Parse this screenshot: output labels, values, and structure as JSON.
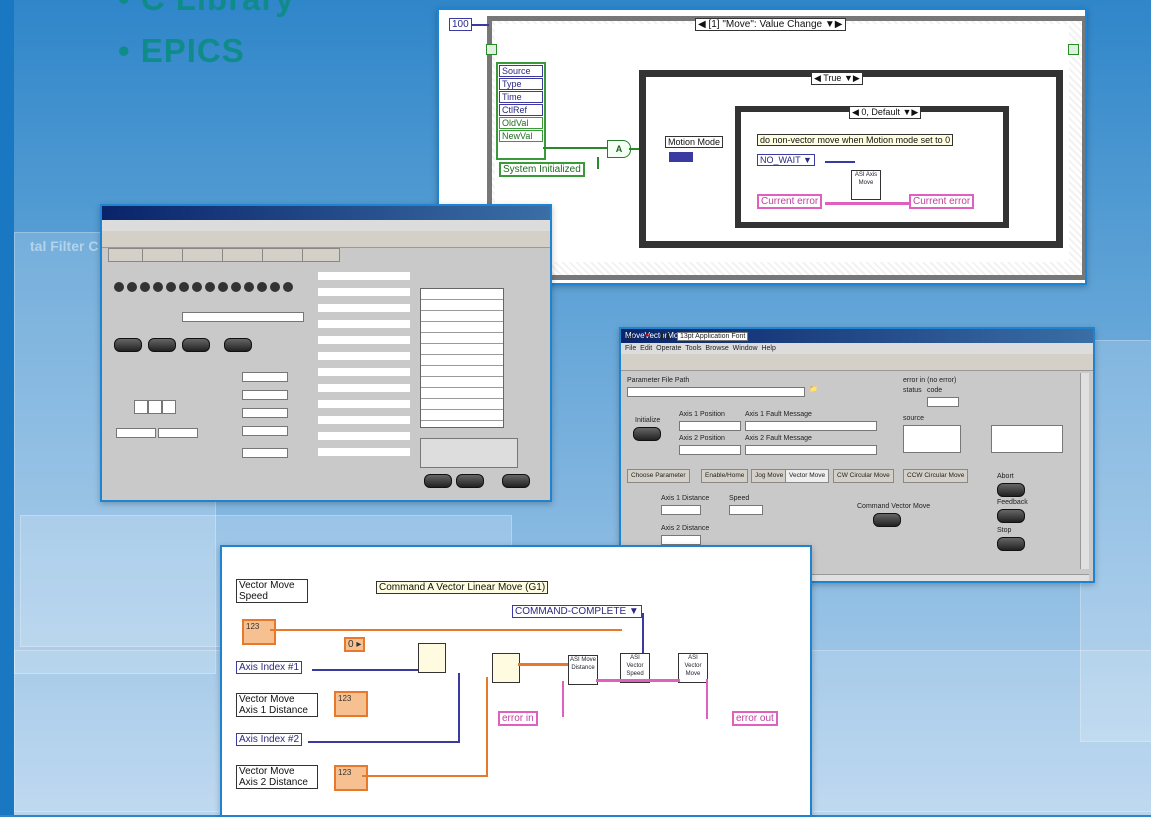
{
  "bullets": [
    "C Library",
    "EPICS"
  ],
  "event_diagram": {
    "loop_count": "100",
    "event_case": "[1] \"Move\": Value Change",
    "event_terminals": [
      "Source",
      "Type",
      "Time",
      "CtlRef",
      "OldVal",
      "NewVal"
    ],
    "system_initialized": "System Initialized",
    "true_case": "True",
    "default_case": "0, Default",
    "motion_mode": "Motion Mode",
    "comment": "do non-vector move when Motion mode set to 0",
    "no_wait": "NO_WAIT",
    "axis_move_vi": "ASI Axis Move",
    "current_error_in": "Current error",
    "current_error_out": "Current error"
  },
  "vector_diagram": {
    "speed_label": "Vector Move Speed",
    "title": "Command A Vector Linear Move (G1)",
    "command_complete": "COMMAND-COMPLETE",
    "axis1": "Axis Index #1",
    "axis2": "Axis Index #2",
    "dist1": "Vector Move Axis 1 Distance",
    "dist2": "Vector Move Axis 2 Distance",
    "error_in": "error in",
    "error_out": "error out",
    "vi_move_distance": "ASI Move Distance",
    "vi_vector_speed": "ASI Vector Speed",
    "vi_vector_move": "ASI Vector Move",
    "const_zero": "0",
    "num_123": "123"
  },
  "front_panel": {
    "title": "MoveVectorMotion.vi Front Panel *",
    "menu": [
      "File",
      "Edit",
      "Operate",
      "Tools",
      "Browse",
      "Window",
      "Help"
    ],
    "app_font": "13pt Application Font",
    "param_path_label": "Parameter File Path",
    "axis1_position": "Axis 1 Position",
    "axis1_fault": "Axis 1 Fault Message",
    "axis2_position": "Axis 2 Position",
    "axis2_fault": "Axis 2 Fault Message",
    "initialize": "Initialize",
    "error_label": "error in (no error)",
    "status": "status",
    "code": "code",
    "source": "source",
    "tabs": [
      "Choose Parameter",
      "Enable/Home",
      "Jog Move",
      "Vector Move",
      "CW Circular Move",
      "CCW Circular Move"
    ],
    "axis1_distance": "Axis 1 Distance",
    "axis2_distance": "Axis 2 Distance",
    "speed": "Speed",
    "command_vector_move": "Command Vector Move",
    "right_buttons": [
      "Abort",
      "Feedback",
      "Stop"
    ]
  }
}
